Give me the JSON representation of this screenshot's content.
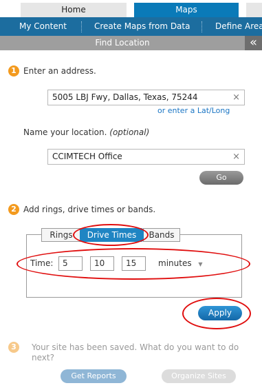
{
  "top_tabs": {
    "home": "Home",
    "maps": "Maps"
  },
  "sub_nav": {
    "my_content": "My Content",
    "create_maps": "Create Maps from Data",
    "define_area": "Define Area"
  },
  "panel": {
    "title": "Find Location",
    "collapse_glyph": "«"
  },
  "step1": {
    "number": "1",
    "label": "Enter an address.",
    "address_value": "5005 LBJ Fwy, Dallas, Texas, 75244",
    "clear_glyph": "×",
    "latlong_link": "or enter a Lat/Long",
    "name_label": "Name your location.",
    "name_optional": "(optional)",
    "name_value": "CCIMTECH Office",
    "go_label": "Go"
  },
  "step2": {
    "number": "2",
    "label": "Add rings, drive times or bands.",
    "tabs": {
      "rings": "Rings",
      "drive_times": "Drive Times",
      "bands": "Bands"
    },
    "time_label": "Time:",
    "time_values": [
      "5",
      "10",
      "15"
    ],
    "unit_label": "minutes",
    "unit_arrow": "▼",
    "apply_label": "Apply"
  },
  "step3": {
    "number": "3",
    "label": "Your site has been saved. What do you want to do next?",
    "reports_label": "Get Reports",
    "organize_label": "Organize Sites"
  },
  "colors": {
    "accent": "#1c6d9f",
    "step_orange": "#f39a1e",
    "annotation_red": "#e00d0d"
  }
}
